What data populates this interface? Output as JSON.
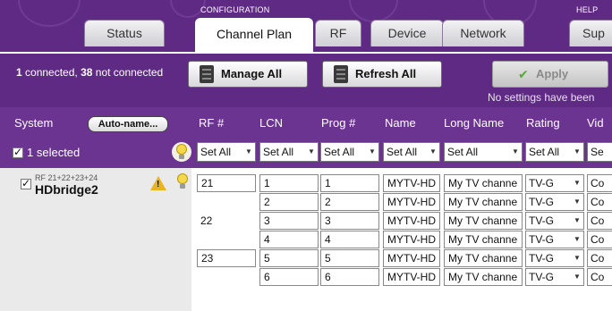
{
  "top_sections": {
    "configuration": "CONFIGURATION",
    "help": "HELP"
  },
  "tabs": [
    {
      "label": "Status"
    },
    {
      "label": "Channel Plan"
    },
    {
      "label": "RF"
    },
    {
      "label": "Device"
    },
    {
      "label": "Network"
    },
    {
      "label": "Sup"
    }
  ],
  "toolbar": {
    "connected_count": "1",
    "connected_label": " connected, ",
    "not_connected_count": "38",
    "not_connected_label": " not connected",
    "manage_all": "Manage All",
    "refresh_all": "Refresh All",
    "apply": "Apply",
    "status": "No settings have been"
  },
  "columns": {
    "system": "System",
    "auto_name": "Auto-name...",
    "rf": "RF #",
    "lcn": "LCN",
    "prog": "Prog #",
    "name": "Name",
    "long_name": "Long Name",
    "rating": "Rating",
    "video": "Vid"
  },
  "selection": {
    "selected_text": "1 selected",
    "set_all": "Set All",
    "set_short": "Se"
  },
  "device": {
    "rf_list": "RF 21+22+23+24",
    "name": "HDbridge2",
    "warning_mark": "!"
  },
  "rows": [
    {
      "rf": "21",
      "rf_style": "box",
      "lcn": "1",
      "prog": "1",
      "name": "MYTV-HD",
      "long_name": "My TV channe",
      "rating": "TV-G",
      "video": "Co"
    },
    {
      "rf": "",
      "rf_style": "none",
      "lcn": "2",
      "prog": "2",
      "name": "MYTV-HD",
      "long_name": "My TV channe",
      "rating": "TV-G",
      "video": "Co"
    },
    {
      "rf": "22",
      "rf_style": "plain",
      "lcn": "3",
      "prog": "3",
      "name": "MYTV-HD",
      "long_name": "My TV channe",
      "rating": "TV-G",
      "video": "Co"
    },
    {
      "rf": "",
      "rf_style": "none",
      "lcn": "4",
      "prog": "4",
      "name": "MYTV-HD",
      "long_name": "My TV channe",
      "rating": "TV-G",
      "video": "Co"
    },
    {
      "rf": "23",
      "rf_style": "box",
      "lcn": "5",
      "prog": "5",
      "name": "MYTV-HD",
      "long_name": "My TV channe",
      "rating": "TV-G",
      "video": "Co"
    },
    {
      "rf": "",
      "rf_style": "none",
      "lcn": "6",
      "prog": "6",
      "name": "MYTV-HD",
      "long_name": "My TV channe",
      "rating": "TV-G",
      "video": "Co"
    }
  ],
  "colors": {
    "purple": "#5e2a83",
    "header_purple": "#6a3490",
    "panel_gray": "#eaeaea"
  },
  "icons": [
    "server-icon",
    "check-icon",
    "bulb-icon",
    "warning-icon",
    "chevron-down-icon"
  ]
}
